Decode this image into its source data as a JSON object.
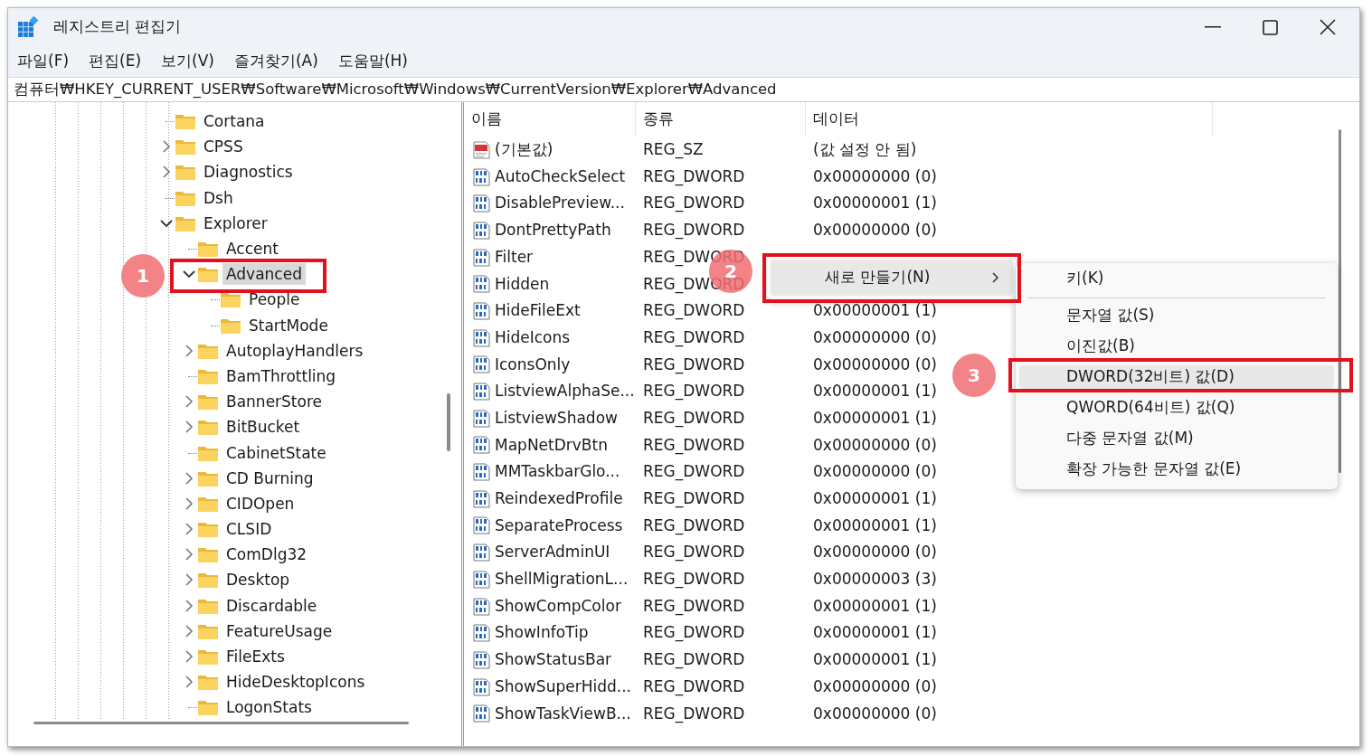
{
  "window": {
    "title": "레지스트리 편집기"
  },
  "menu": [
    {
      "label": "파일(F)"
    },
    {
      "label": "편집(E)"
    },
    {
      "label": "보기(V)"
    },
    {
      "label": "즐겨찾기(A)"
    },
    {
      "label": "도움말(H)"
    }
  ],
  "address": "컴퓨터₩HKEY_CURRENT_USER₩Software₩Microsoft₩Windows₩CurrentVersion₩Explorer₩Advanced",
  "tree": [
    {
      "name": "Cortana",
      "kind": "leaf",
      "selected": false
    },
    {
      "name": "CPSS",
      "kind": "collapsed",
      "selected": false
    },
    {
      "name": "Diagnostics",
      "kind": "collapsed",
      "selected": false
    },
    {
      "name": "Dsh",
      "kind": "leaf",
      "selected": false
    },
    {
      "name": "Explorer",
      "kind": "expanded",
      "selected": false,
      "children": [
        {
          "name": "Accent",
          "kind": "leaf",
          "selected": false
        },
        {
          "name": "Advanced",
          "kind": "expanded",
          "selected": true,
          "children": [
            {
              "name": "People",
              "kind": "leaf",
              "selected": false
            },
            {
              "name": "StartMode",
              "kind": "leaf",
              "selected": false
            }
          ]
        },
        {
          "name": "AutoplayHandlers",
          "kind": "collapsed",
          "selected": false
        },
        {
          "name": "BamThrottling",
          "kind": "leaf",
          "selected": false
        },
        {
          "name": "BannerStore",
          "kind": "collapsed",
          "selected": false
        },
        {
          "name": "BitBucket",
          "kind": "collapsed",
          "selected": false
        },
        {
          "name": "CabinetState",
          "kind": "leaf",
          "selected": false
        },
        {
          "name": "CD Burning",
          "kind": "collapsed",
          "selected": false
        },
        {
          "name": "CIDOpen",
          "kind": "collapsed",
          "selected": false
        },
        {
          "name": "CLSID",
          "kind": "collapsed",
          "selected": false
        },
        {
          "name": "ComDlg32",
          "kind": "collapsed",
          "selected": false
        },
        {
          "name": "Desktop",
          "kind": "collapsed",
          "selected": false
        },
        {
          "name": "Discardable",
          "kind": "collapsed",
          "selected": false
        },
        {
          "name": "FeatureUsage",
          "kind": "collapsed",
          "selected": false
        },
        {
          "name": "FileExts",
          "kind": "collapsed",
          "selected": false
        },
        {
          "name": "HideDesktopIcons",
          "kind": "collapsed",
          "selected": false
        },
        {
          "name": "LogonStats",
          "kind": "leaf",
          "selected": false
        }
      ]
    }
  ],
  "list": {
    "columns": [
      "이름",
      "종류",
      "데이터"
    ],
    "rows": [
      {
        "kind": "string",
        "name": "(기본값)",
        "type": "REG_SZ",
        "data": "(값 설정 안 됨)"
      },
      {
        "kind": "dword",
        "name": "AutoCheckSelect",
        "type": "REG_DWORD",
        "data": "0x00000000 (0)"
      },
      {
        "kind": "dword",
        "name": "DisablePreview...",
        "type": "REG_DWORD",
        "data": "0x00000001 (1)"
      },
      {
        "kind": "dword",
        "name": "DontPrettyPath",
        "type": "REG_DWORD",
        "data": "0x00000000 (0)"
      },
      {
        "kind": "dword",
        "name": "Filter",
        "type": "REG_DWORD"
      },
      {
        "kind": "dword",
        "name": "Hidden",
        "type": "REG_DWORD"
      },
      {
        "kind": "dword",
        "name": "HideFileExt",
        "type": "REG_DWORD",
        "data": "0x00000001 (1)"
      },
      {
        "kind": "dword",
        "name": "HideIcons",
        "type": "REG_DWORD",
        "data": "0x00000000 (0)"
      },
      {
        "kind": "dword",
        "name": "IconsOnly",
        "type": "REG_DWORD",
        "data": "0x00000000 (0)"
      },
      {
        "kind": "dword",
        "name": "ListviewAlphaSe...",
        "type": "REG_DWORD",
        "data": "0x00000001 (1)"
      },
      {
        "kind": "dword",
        "name": "ListviewShadow",
        "type": "REG_DWORD",
        "data": "0x00000001 (1)"
      },
      {
        "kind": "dword",
        "name": "MapNetDrvBtn",
        "type": "REG_DWORD",
        "data": "0x00000000 (0)"
      },
      {
        "kind": "dword",
        "name": "MMTaskbarGlo...",
        "type": "REG_DWORD",
        "data": "0x00000000 (0)"
      },
      {
        "kind": "dword",
        "name": "ReindexedProfile",
        "type": "REG_DWORD",
        "data": "0x00000001 (1)"
      },
      {
        "kind": "dword",
        "name": "SeparateProcess",
        "type": "REG_DWORD",
        "data": "0x00000001 (1)"
      },
      {
        "kind": "dword",
        "name": "ServerAdminUI",
        "type": "REG_DWORD",
        "data": "0x00000000 (0)"
      },
      {
        "kind": "dword",
        "name": "ShellMigrationL...",
        "type": "REG_DWORD",
        "data": "0x00000003 (3)"
      },
      {
        "kind": "dword",
        "name": "ShowCompColor",
        "type": "REG_DWORD",
        "data": "0x00000001 (1)"
      },
      {
        "kind": "dword",
        "name": "ShowInfoTip",
        "type": "REG_DWORD",
        "data": "0x00000001 (1)"
      },
      {
        "kind": "dword",
        "name": "ShowStatusBar",
        "type": "REG_DWORD",
        "data": "0x00000001 (1)"
      },
      {
        "kind": "dword",
        "name": "ShowSuperHidd...",
        "type": "REG_DWORD",
        "data": "0x00000000 (0)"
      },
      {
        "kind": "dword",
        "name": "ShowTaskViewB...",
        "type": "REG_DWORD",
        "data": "0x00000000 (0)"
      }
    ]
  },
  "context_menu": {
    "items": [
      {
        "label": "새로 만들기(N)",
        "submenu": true,
        "selected": true
      }
    ]
  },
  "submenu": {
    "items": [
      {
        "kind": "item",
        "label": "키(K)",
        "selected": false
      },
      {
        "kind": "separator"
      },
      {
        "kind": "item",
        "label": "문자열 값(S)",
        "selected": false
      },
      {
        "kind": "item",
        "label": "이진값(B)",
        "selected": false
      },
      {
        "kind": "item",
        "label": "DWORD(32비트) 값(D)",
        "selected": true
      },
      {
        "kind": "item",
        "label": "QWORD(64비트) 값(Q)",
        "selected": false
      },
      {
        "kind": "item",
        "label": "다중 문자열 값(M)",
        "selected": false
      },
      {
        "kind": "item",
        "label": "확장 가능한 문자열 값(E)",
        "selected": false
      }
    ]
  },
  "callouts": [
    {
      "number": "1"
    },
    {
      "number": "2"
    },
    {
      "number": "3"
    }
  ]
}
